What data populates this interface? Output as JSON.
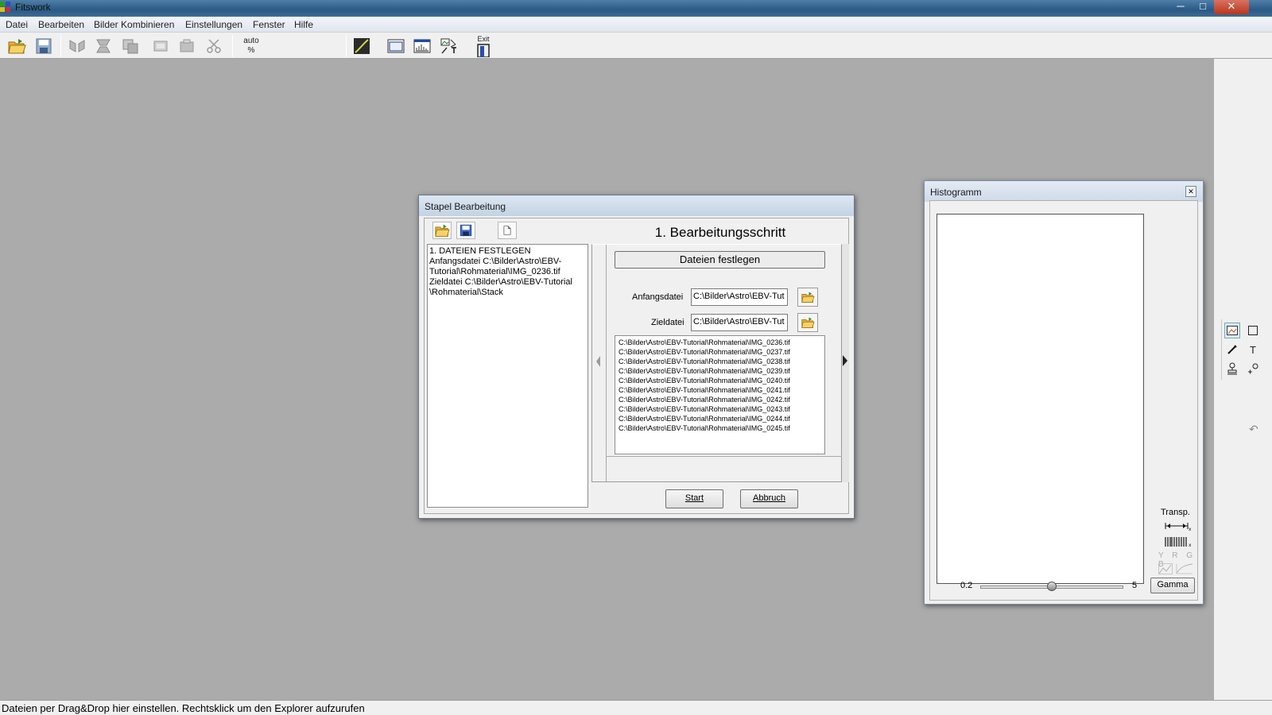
{
  "window": {
    "title": "Fitswork"
  },
  "menu": [
    "Datei",
    "Bearbeiten",
    "Bilder Kombinieren",
    "Einstellungen",
    "Fenster",
    "Hilfe"
  ],
  "toolbar": {
    "auto_label": "auto",
    "percent_label": "%",
    "exit_label": "Exit"
  },
  "batch_dialog": {
    "title": "Stapel Bearbeitung",
    "step_title": "1. Bearbeitungsschritt",
    "step_header": "Dateien festlegen",
    "summary_lines": [
      "1. DATEIEN FESTLEGEN",
      "Anfangsdatei   C:\\Bilder\\Astro\\EBV-",
      "Tutorial\\Rohmaterial\\IMG_0236.tif",
      "Zieldatei   C:\\Bilder\\Astro\\EBV-Tutorial",
      "\\Rohmaterial\\Stack"
    ],
    "start_label": "Anfangsdatei",
    "start_value": "C:\\Bilder\\Astro\\EBV-Tut",
    "target_label": "Zieldatei",
    "target_value": "C:\\Bilder\\Astro\\EBV-Tut",
    "files": [
      "C:\\Bilder\\Astro\\EBV-Tutorial\\Rohmaterial\\IMG_0236.tif",
      "C:\\Bilder\\Astro\\EBV-Tutorial\\Rohmaterial\\IMG_0237.tif",
      "C:\\Bilder\\Astro\\EBV-Tutorial\\Rohmaterial\\IMG_0238.tif",
      "C:\\Bilder\\Astro\\EBV-Tutorial\\Rohmaterial\\IMG_0239.tif",
      "C:\\Bilder\\Astro\\EBV-Tutorial\\Rohmaterial\\IMG_0240.tif",
      "C:\\Bilder\\Astro\\EBV-Tutorial\\Rohmaterial\\IMG_0241.tif",
      "C:\\Bilder\\Astro\\EBV-Tutorial\\Rohmaterial\\IMG_0242.tif",
      "C:\\Bilder\\Astro\\EBV-Tutorial\\Rohmaterial\\IMG_0243.tif",
      "C:\\Bilder\\Astro\\EBV-Tutorial\\Rohmaterial\\IMG_0244.tif",
      "C:\\Bilder\\Astro\\EBV-Tutorial\\Rohmaterial\\IMG_0245.tif"
    ],
    "start_button": "Start",
    "cancel_button": "Abbruch"
  },
  "histogram": {
    "title": "Histogramm",
    "transp_label": "Transp.",
    "channels": [
      "Y",
      "R",
      "G",
      "B"
    ],
    "gamma_min": "0.2",
    "gamma_max": "5",
    "gamma_button": "Gamma",
    "gamma_slider_fraction": 0.5
  },
  "status": {
    "text": "Dateien per Drag&Drop hier einstellen. Rechtsklick um den Explorer aufzurufen"
  }
}
